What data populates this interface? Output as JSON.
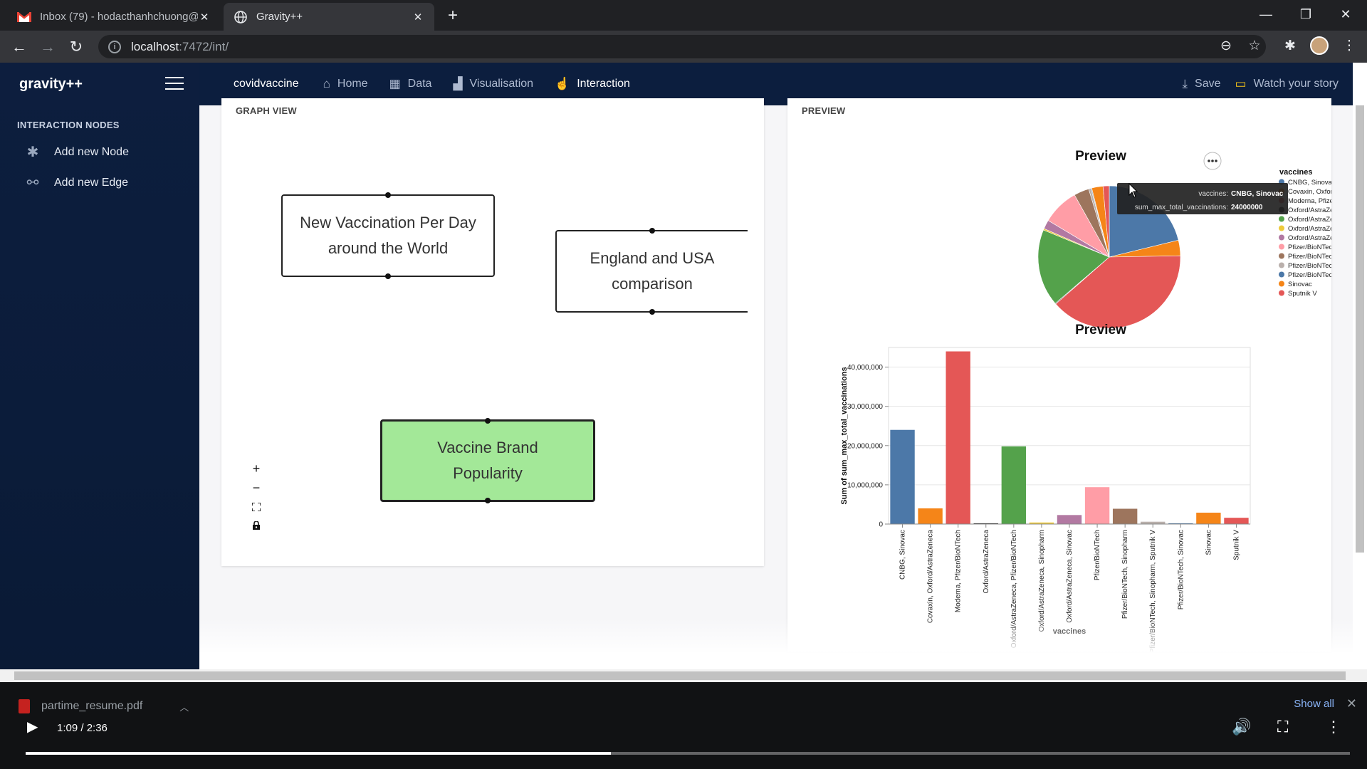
{
  "browser": {
    "tabs": [
      {
        "title": "Inbox (79) - hodacthanhchuong@",
        "active": false
      },
      {
        "title": "Gravity++",
        "active": true
      }
    ],
    "url_host": "localhost",
    "url_rest": ":7472/int/"
  },
  "app": {
    "brand": "gravity++",
    "sidebar": {
      "title": "INTERACTION NODES",
      "items": [
        {
          "label": "Add new Node",
          "icon": "puzzle-icon"
        },
        {
          "label": "Add new Edge",
          "icon": "link-icon"
        }
      ]
    },
    "nav": {
      "project": "covidvaccine",
      "items": [
        {
          "label": "Home",
          "icon": "home-icon"
        },
        {
          "label": "Data",
          "icon": "table-icon"
        },
        {
          "label": "Visualisation",
          "icon": "bar-chart-icon"
        },
        {
          "label": "Interaction",
          "icon": "pointer-icon",
          "active": true
        }
      ],
      "save": "Save",
      "watch": "Watch your story"
    }
  },
  "graph": {
    "title": "GRAPH VIEW",
    "nodes": [
      {
        "label": "New Vaccination Per Day around the World",
        "color": "#ffffff"
      },
      {
        "label": "England and USA comparison",
        "color": "#ffffff"
      },
      {
        "label": "Vaccine Brand Popularity",
        "color": "#a3e898"
      }
    ],
    "controls": [
      "+",
      "−"
    ]
  },
  "preview": {
    "title": "PREVIEW",
    "pie_title": "Preview",
    "bar_title": "Preview",
    "legend_title": "vaccines",
    "tooltip": {
      "k1": "vaccines:",
      "v1": "CNBG, Sinovac",
      "k2": "sum_max_total_vaccinations:",
      "v2": "24000000"
    }
  },
  "chart_data": [
    {
      "type": "pie",
      "title": "Preview",
      "legend_title": "vaccines",
      "categories": [
        "CNBG, Sinovac",
        "Covaxin, Oxford/AstraZeneca",
        "Moderna, Pfizer/BioNTech",
        "Oxford/AstraZeneca",
        "Oxford/AstraZeneca, Pfizer/BioNTech",
        "Oxford/AstraZeneca, Sinopharm",
        "Oxford/AstraZeneca, Sinovac",
        "Pfizer/BioNTech",
        "Pfizer/BioNTech, Sinopharm",
        "Pfizer/BioNTech, Sinopharm, Sputnik V",
        "Pfizer/BioNTech, Sinovac",
        "Sinovac",
        "Sputnik V"
      ],
      "legend_labels": [
        "CNBG, Sinovac",
        "Covaxin, Oxford/As",
        "Moderna, Pfizer/Bic",
        "Oxford/AstraZeneca",
        "Oxford/AstraZeneca",
        "Oxford/AstraZeneca",
        "Oxford/AstraZeneca",
        "Pfizer/BioNTech",
        "Pfizer/BioNTech, Si",
        "Pfizer/BioNTech, Si",
        "Pfizer/BioNTech, Si",
        "Sinovac",
        "Sputnik V"
      ],
      "values": [
        24000000,
        4000000,
        44000000,
        200000,
        19800000,
        400000,
        2300000,
        9400000,
        3900000,
        600000,
        200000,
        2900000,
        1600000
      ],
      "colors": [
        "#4c78a8",
        "#f58518",
        "#e45756",
        "#222222",
        "#54a24b",
        "#eeca3b",
        "#b279a2",
        "#ff9da6",
        "#9d755d",
        "#bab0ac",
        "#4c78a8",
        "#f58518",
        "#e45756"
      ]
    },
    {
      "type": "bar",
      "title": "Preview",
      "xlabel": "vaccines",
      "ylabel": "Sum of sum_max_total_vaccinations",
      "ylim": [
        0,
        45000000
      ],
      "yticks": [
        0,
        10000000,
        20000000,
        30000000,
        40000000
      ],
      "ytick_labels": [
        "0",
        "10,000,000",
        "20,000,000",
        "30,000,000",
        "40,000,000"
      ],
      "categories": [
        "CNBG, Sinovac",
        "Covaxin, Oxford/AstraZeneca",
        "Moderna, Pfizer/BioNTech",
        "Oxford/AstraZeneca",
        "Oxford/AstraZeneca, Pfizer/BioNTech",
        "Oxford/AstraZeneca, Sinopharm",
        "Oxford/AstraZeneca, Sinovac",
        "Pfizer/BioNTech",
        "Pfizer/BioNTech, Sinopharm",
        "Pfizer/BioNTech, Sinopharm, Sputnik V",
        "Pfizer/BioNTech, Sinovac",
        "Sinovac",
        "Sputnik V"
      ],
      "values": [
        24000000,
        4000000,
        44000000,
        200000,
        19800000,
        400000,
        2300000,
        9400000,
        3900000,
        600000,
        200000,
        2900000,
        1600000
      ],
      "colors": [
        "#4c78a8",
        "#f58518",
        "#e45756",
        "#222222",
        "#54a24b",
        "#eeca3b",
        "#b279a2",
        "#ff9da6",
        "#9d755d",
        "#bab0ac",
        "#4c78a8",
        "#f58518",
        "#e45756"
      ]
    }
  ],
  "download": {
    "file": "partime_resume.pdf",
    "show_all": "Show all"
  },
  "video": {
    "time": "1:09 / 2:36",
    "progress": 0.442
  }
}
